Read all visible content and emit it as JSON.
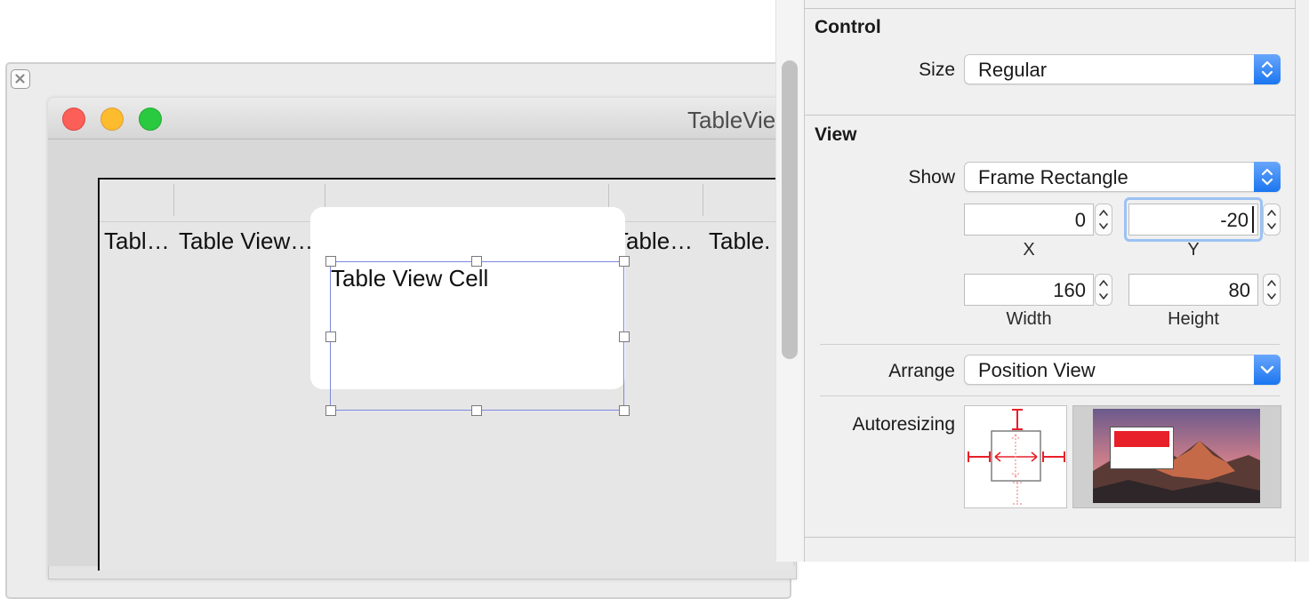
{
  "canvas": {
    "window_title": "TableVie",
    "columns": [
      {
        "label": "Tabl…"
      },
      {
        "label": "Table View…"
      },
      {
        "label": "Table…"
      },
      {
        "label": "Table."
      }
    ],
    "cell_label": "Table View Cell"
  },
  "inspector": {
    "control": {
      "title": "Control",
      "size_label": "Size",
      "size_value": "Regular"
    },
    "view": {
      "title": "View",
      "show_label": "Show",
      "show_value": "Frame Rectangle",
      "x_value": "0",
      "y_value": "-20",
      "x_label": "X",
      "y_label": "Y",
      "width_value": "160",
      "height_value": "80",
      "width_label": "Width",
      "height_label": "Height",
      "arrange_label": "Arrange",
      "arrange_value": "Position View",
      "autoresizing_label": "Autoresizing"
    }
  },
  "colors": {
    "accent": "#1b76f0",
    "selection": "#7d87e0",
    "autoresize_red": "#e8202a",
    "focus_ring": "#9cc2f3"
  },
  "icons": {
    "close_badge": "close-x-icon",
    "popup_arrows": "up-down-chevron-icon",
    "popup_down": "chevron-down-icon",
    "stepper": "stepper-arrows-icon"
  }
}
